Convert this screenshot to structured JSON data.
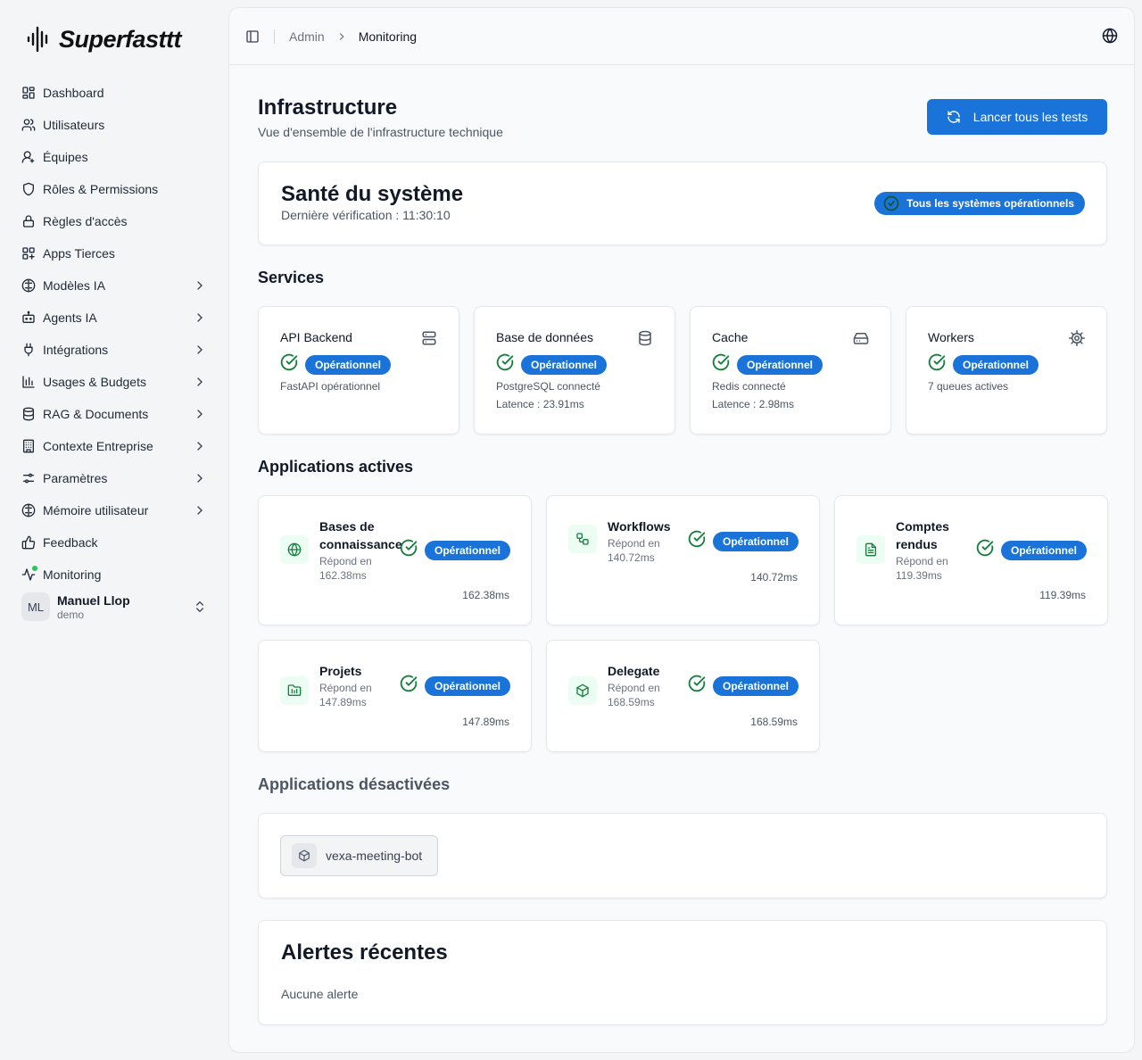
{
  "brand": {
    "name": "Superfasttt"
  },
  "sidebar": {
    "items": [
      {
        "label": "Dashboard",
        "icon": "dashboard-icon",
        "chevron": false
      },
      {
        "label": "Utilisateurs",
        "icon": "users-icon",
        "chevron": false
      },
      {
        "label": "Équipes",
        "icon": "teams-icon",
        "chevron": false
      },
      {
        "label": "Rôles & Permissions",
        "icon": "shield-icon",
        "chevron": false
      },
      {
        "label": "Règles d'accès",
        "icon": "lock-icon",
        "chevron": false
      },
      {
        "label": "Apps Tierces",
        "icon": "apps-icon",
        "chevron": false
      },
      {
        "label": "Modèles IA",
        "icon": "brain-icon",
        "chevron": true
      },
      {
        "label": "Agents IA",
        "icon": "bot-icon",
        "chevron": true
      },
      {
        "label": "Intégrations",
        "icon": "plug-icon",
        "chevron": true
      },
      {
        "label": "Usages & Budgets",
        "icon": "bar-chart-icon",
        "chevron": true
      },
      {
        "label": "RAG & Documents",
        "icon": "database-icon",
        "chevron": true
      },
      {
        "label": "Contexte Entreprise",
        "icon": "building-icon",
        "chevron": true
      },
      {
        "label": "Paramètres",
        "icon": "settings-sliders-icon",
        "chevron": true
      },
      {
        "label": "Mémoire utilisateur",
        "icon": "memory-brain-icon",
        "chevron": true
      },
      {
        "label": "Feedback",
        "icon": "thumbs-up-icon",
        "chevron": false
      },
      {
        "label": "Monitoring",
        "icon": "activity-icon",
        "chevron": false
      }
    ],
    "user": {
      "initials": "ML",
      "name": "Manuel Llop",
      "role": "demo"
    }
  },
  "header": {
    "breadcrumb": [
      "Admin",
      "Monitoring"
    ]
  },
  "page": {
    "title": "Infrastructure",
    "subtitle": "Vue d'ensemble de l'infrastructure technique",
    "run_all_label": "Lancer tous les tests"
  },
  "health": {
    "title": "Santé du système",
    "last_check": "Dernière vérification : 11:30:10",
    "badge": "Tous les systèmes opérationnels"
  },
  "services": {
    "title": "Services",
    "items": [
      {
        "name": "API Backend",
        "icon": "server-icon",
        "status": "Opérationnel",
        "lines": [
          "FastAPI opérationnel"
        ]
      },
      {
        "name": "Base de données",
        "icon": "database-icon",
        "status": "Opérationnel",
        "lines": [
          "PostgreSQL connecté",
          "Latence : 23.91ms"
        ]
      },
      {
        "name": "Cache",
        "icon": "hard-drive-icon",
        "status": "Opérationnel",
        "lines": [
          "Redis connecté",
          "Latence : 2.98ms"
        ]
      },
      {
        "name": "Workers",
        "icon": "cog-icon",
        "status": "Opérationnel",
        "lines": [
          "7 queues actives"
        ]
      }
    ]
  },
  "active_apps": {
    "title": "Applications actives",
    "items": [
      {
        "name": "Bases de connaissance",
        "icon": "globe-icon",
        "response": "Répond en 162.38ms",
        "status": "Opérationnel",
        "latency": "162.38ms"
      },
      {
        "name": "Workflows",
        "icon": "workflow-icon",
        "response": "Répond en 140.72ms",
        "status": "Opérationnel",
        "latency": "140.72ms"
      },
      {
        "name": "Comptes rendus",
        "icon": "file-text-icon",
        "response": "Répond en 119.39ms",
        "status": "Opérationnel",
        "latency": "119.39ms"
      },
      {
        "name": "Projets",
        "icon": "folder-icon",
        "response": "Répond en 147.89ms",
        "status": "Opérationnel",
        "latency": "147.89ms"
      },
      {
        "name": "Delegate",
        "icon": "package-icon",
        "response": "Répond en 168.59ms",
        "status": "Opérationnel",
        "latency": "168.59ms"
      }
    ]
  },
  "disabled_apps": {
    "title": "Applications désactivées",
    "items": [
      {
        "name": "vexa-meeting-bot",
        "icon": "package-icon"
      }
    ]
  },
  "alerts": {
    "title": "Alertes récentes",
    "empty": "Aucune alerte"
  },
  "colors": {
    "accent": "#1a73d9",
    "success": "#15803d",
    "app_icon_bg": "#ecfdf3"
  }
}
